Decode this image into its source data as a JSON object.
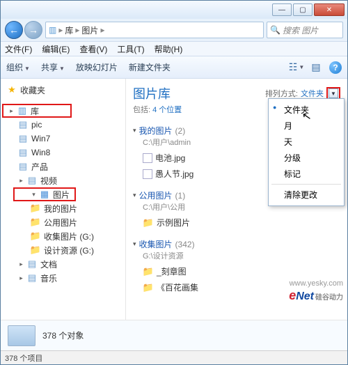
{
  "window": {
    "min_glyph": "—",
    "max_glyph": "▢",
    "close_glyph": "✕"
  },
  "address": {
    "root": "库",
    "current": "图片",
    "search_placeholder": "搜索 图片"
  },
  "menubar": {
    "file": "文件(F)",
    "edit": "编辑(E)",
    "view": "查看(V)",
    "tools": "工具(T)",
    "help": "帮助(H)"
  },
  "toolbar": {
    "organize": "组织",
    "share": "共享",
    "slideshow": "放映幻灯片",
    "newfolder": "新建文件夹"
  },
  "sidebar": {
    "favorites": "收藏夹",
    "libraries": "库",
    "items": [
      {
        "label": "pic"
      },
      {
        "label": "Win7"
      },
      {
        "label": "Win8"
      },
      {
        "label": "产品"
      },
      {
        "label": "视频"
      }
    ],
    "pictures": "图片",
    "picture_items": [
      {
        "label": "我的图片"
      },
      {
        "label": "公用图片"
      },
      {
        "label": "收集图片 (G:)"
      },
      {
        "label": "设计资源 (G:)"
      }
    ],
    "documents": "文档",
    "music": "音乐"
  },
  "content": {
    "title": "图片库",
    "subtitle_prefix": "包括: ",
    "subtitle_link": "4 个位置",
    "sort_label": "排列方式:",
    "sort_value": "文件夹",
    "groups": [
      {
        "name": "我的图片",
        "count": "(2)",
        "path": "C:\\用户\\admin",
        "items": [
          "电池.jpg",
          "愚人节.jpg"
        ]
      },
      {
        "name": "公用图片",
        "count": "(1)",
        "path": "C:\\用户\\公用",
        "items": [
          "示例图片"
        ]
      },
      {
        "name": "收集图片",
        "count": "(342)",
        "path": "G:\\设计资源",
        "items": [
          "_刻章图",
          "《百花画集"
        ]
      }
    ]
  },
  "dropdown": {
    "items": [
      "文件夹",
      "月",
      "天",
      "分级",
      "标记"
    ],
    "clear": "清除更改"
  },
  "details": {
    "count_label": "378 个对象"
  },
  "status": {
    "text": "378 个项目"
  },
  "watermark": {
    "site": "www.yesky.com",
    "brand_e": "e",
    "brand_net": "Net",
    "brand_tag": "硅谷动力"
  }
}
